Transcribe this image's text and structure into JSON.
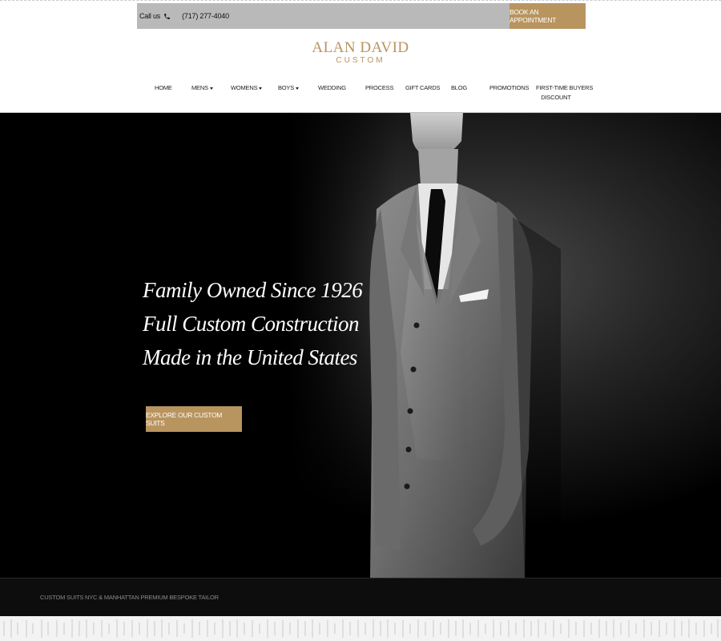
{
  "topbar": {
    "call_label": "Call us",
    "phone": "(717) 277-4040",
    "book_label": "BOOK AN APPOINTMENT"
  },
  "logo": {
    "line1": "ALAN DAVID",
    "line2": "CUSTOM"
  },
  "nav": {
    "items": [
      {
        "label": "HOME"
      },
      {
        "label": "MENS"
      },
      {
        "label": "WOMENS"
      },
      {
        "label": "BOYS"
      },
      {
        "label": "WEDDING"
      },
      {
        "label": "PROCESS"
      },
      {
        "label": "GIFT CARDS"
      },
      {
        "label": "BLOG"
      },
      {
        "label": "PROMOTIONS"
      },
      {
        "label": "FIRST-TIME BUYERS",
        "label2": "DISCOUNT"
      }
    ]
  },
  "hero": {
    "line1": "Family Owned Since 1926",
    "line2": "Full Custom Construction",
    "line3": "Made in the United States",
    "cta_label": "EXPLORE OUR CUSTOM SUITS"
  },
  "footer": {
    "text": "CUSTOM SUITS NYC & MANHATTAN PREMIUM BESPOKE TAILOR"
  },
  "colors": {
    "accent": "#b8945f",
    "topbar_bg": "#b9b9b9",
    "hero_bg": "#000000"
  }
}
